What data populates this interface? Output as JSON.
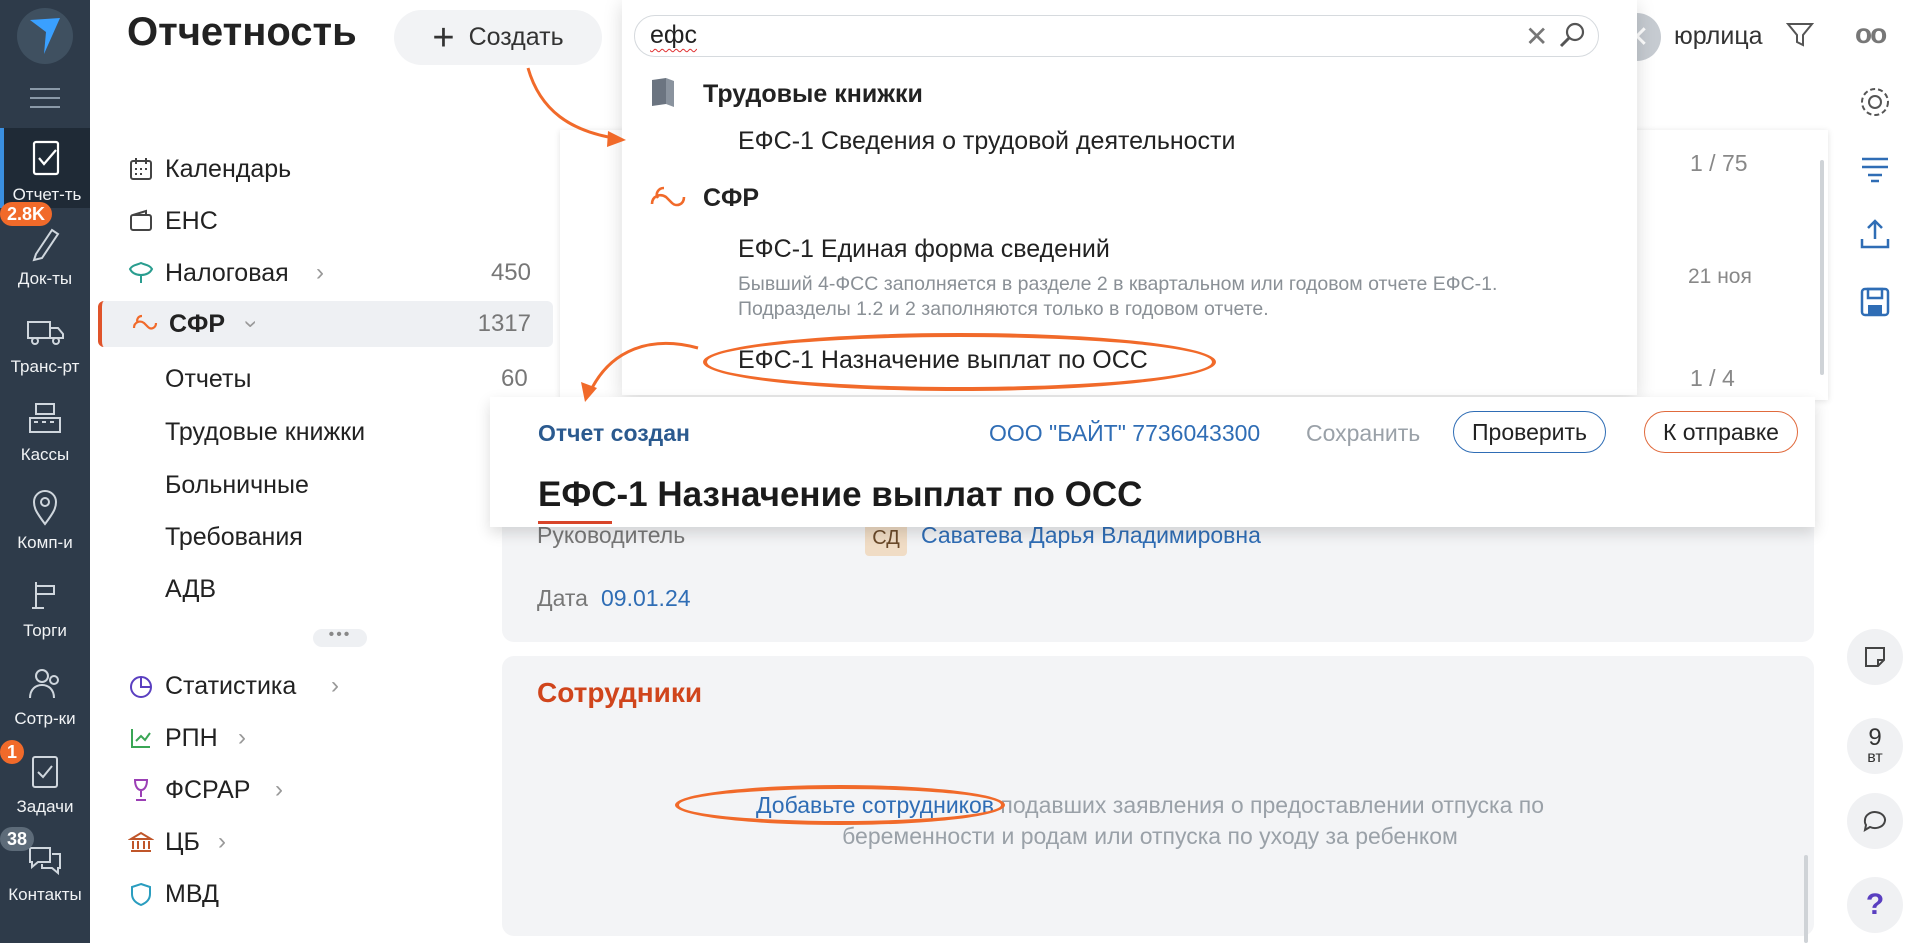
{
  "rail": {
    "items": [
      {
        "label": "Отчет-ть"
      },
      {
        "label": "Док-ты",
        "badge": "2.8K"
      },
      {
        "label": "Транс-рт"
      },
      {
        "label": "Кассы"
      },
      {
        "label": "Комп-и"
      },
      {
        "label": "Торги"
      },
      {
        "label": "Сотр-ки"
      },
      {
        "label": "Задачи",
        "badge": "1"
      },
      {
        "label": "Контакты",
        "badge": "38"
      }
    ]
  },
  "header": {
    "title": "Отчетность",
    "create_label": "Создать",
    "org_filter": "юрлица",
    "more": "оо"
  },
  "nav": {
    "items": [
      {
        "label": "Календарь"
      },
      {
        "label": "ЕНС"
      },
      {
        "label": "Налоговая",
        "count": "450"
      },
      {
        "label": "СФР",
        "count": "1317"
      },
      {
        "label": "Статистика"
      },
      {
        "label": "РПН"
      },
      {
        "label": "ФСРАР"
      },
      {
        "label": "ЦБ"
      },
      {
        "label": "МВД"
      }
    ],
    "sub": [
      {
        "label": "Отчеты",
        "count": "60"
      },
      {
        "label": "Трудовые книжки"
      },
      {
        "label": "Больничные"
      },
      {
        "label": "Требования"
      },
      {
        "label": "АДВ"
      }
    ]
  },
  "list": {
    "counts": [
      "1 / 75",
      "21 ноя",
      "1 / 4"
    ]
  },
  "search": {
    "query": "ефс",
    "groups": [
      {
        "title": "Трудовые книжки",
        "results": [
          {
            "title": "ЕФС-1 Сведения о трудовой деятельности"
          }
        ]
      },
      {
        "title": "СФР",
        "results": [
          {
            "title": "ЕФС-1 Единая форма сведений",
            "desc1": "Бывший 4-ФСС заполняется в разделе 2 в квартальном или годовом отчете ЕФС-1.",
            "desc2": "Подразделы 1.2 и 2 заполняются только в годовом отчете."
          },
          {
            "title": "ЕФС-1 Назначение выплат по ОСС"
          }
        ]
      }
    ]
  },
  "report": {
    "status": "Отчет создан",
    "org": "ООО \"БАЙТ\" 7736043300",
    "save_label": "Сохранить",
    "check_label": "Проверить",
    "send_label": "К отправке",
    "title": "ЕФС-1 Назначение выплат по ОСС",
    "manager_label": "Руководитель",
    "manager_initials": "СД",
    "manager_name": "Саватева Дарья Владимировна",
    "date_label": "Дата",
    "date_value": "09.01.24",
    "employees_title": "Сотрудники",
    "add_employees_link": "Добавьте сотрудников",
    "hint_line1": "подавших заявления о предоставлении отпуска по",
    "hint_line2": "беременности и родам или отпуска по уходу за ребенком"
  },
  "right_rail": {
    "day_number": "9",
    "day_name": "вт",
    "help": "?"
  },
  "colors": {
    "rail_bg": "#2e3b4a",
    "accent_orange": "#f16a2a",
    "link_blue": "#2f6db5",
    "section_red": "#d0451c"
  }
}
